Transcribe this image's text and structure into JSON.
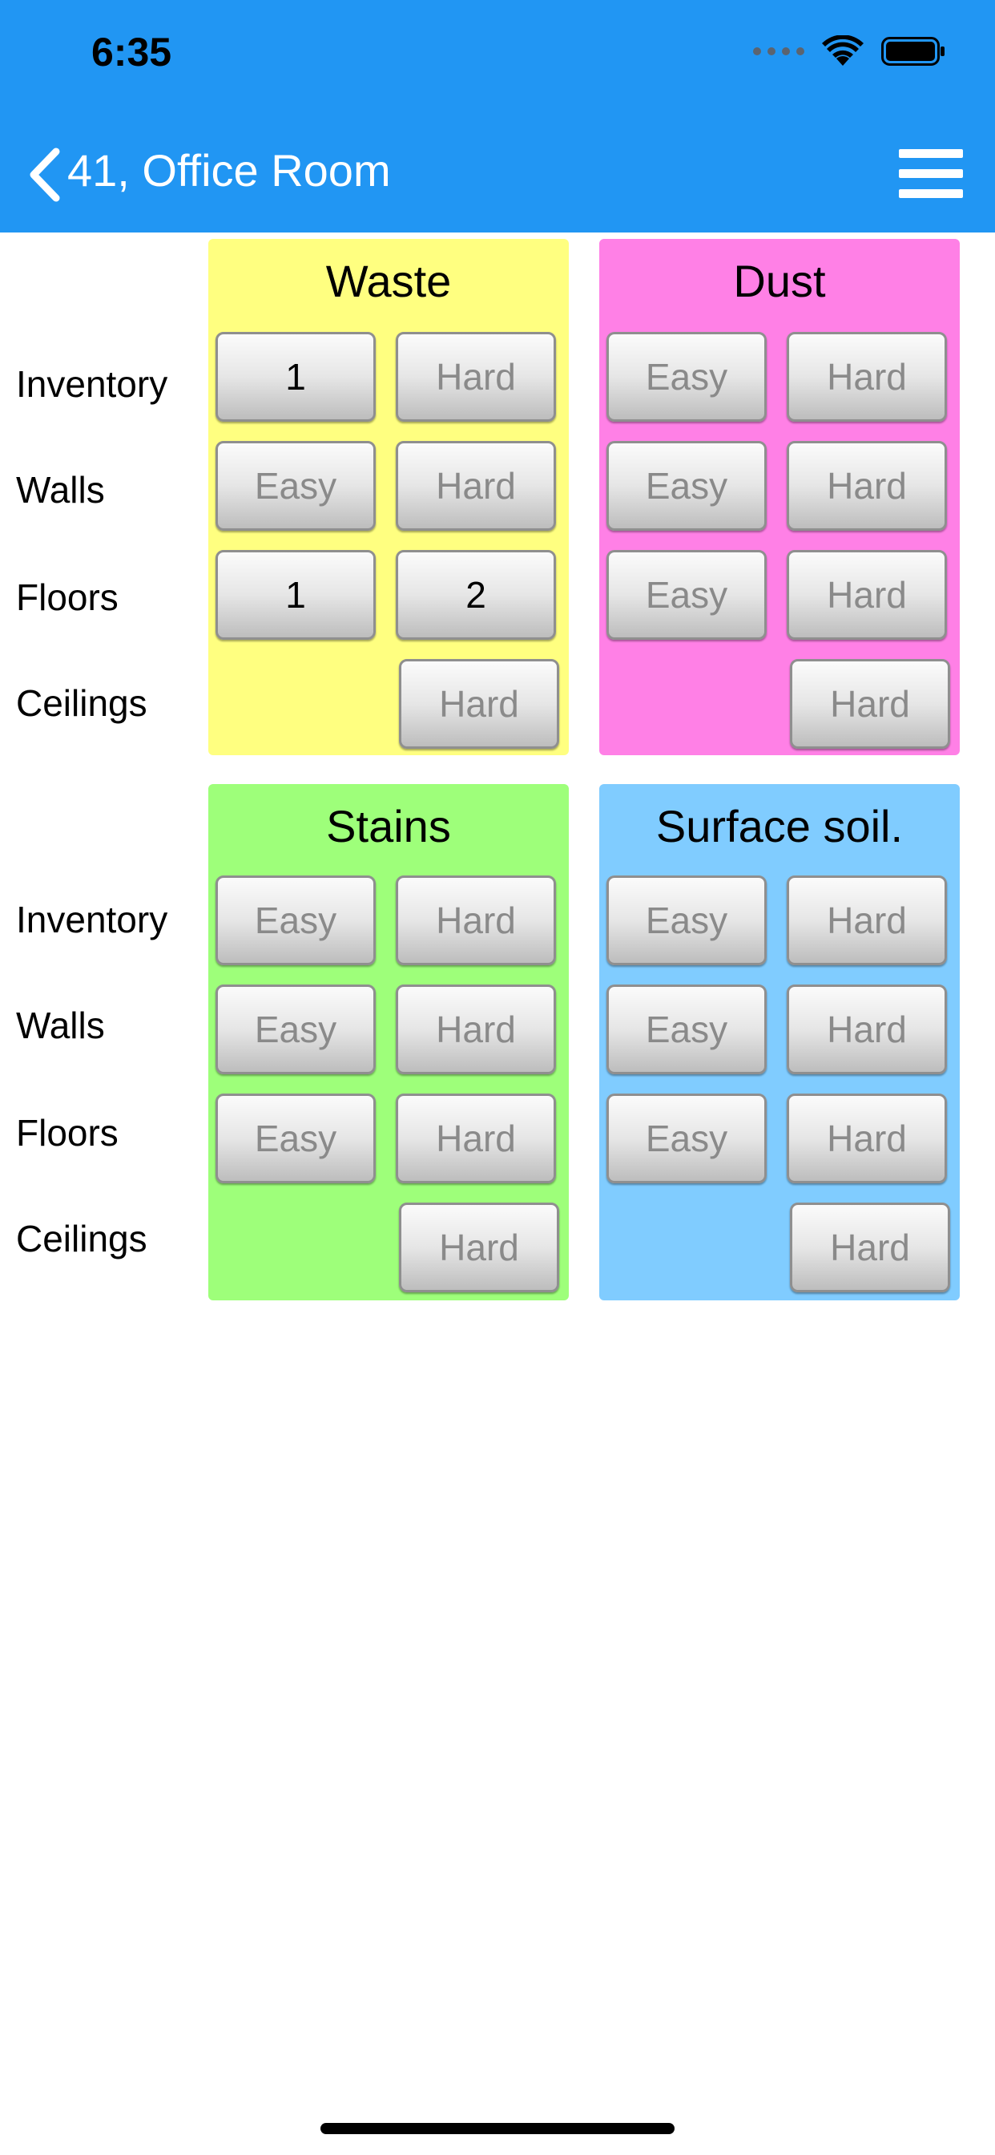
{
  "status_bar": {
    "time": "6:35"
  },
  "nav": {
    "title": "41, Office Room"
  },
  "row_labels": [
    "Inventory",
    "Walls",
    "Floors",
    "Ceilings"
  ],
  "panels": [
    {
      "title": "Waste",
      "color": "#FFFF80",
      "buttons": [
        [
          "1",
          "Hard"
        ],
        [
          "Easy",
          "Hard"
        ],
        [
          "1",
          "2"
        ],
        [
          "Hard"
        ]
      ],
      "active": [
        [
          true,
          false
        ],
        [
          false,
          false
        ],
        [
          true,
          true
        ],
        [
          false
        ]
      ]
    },
    {
      "title": "Dust",
      "color": "#FF80E6",
      "buttons": [
        [
          "Easy",
          "Hard"
        ],
        [
          "Easy",
          "Hard"
        ],
        [
          "Easy",
          "Hard"
        ],
        [
          "Hard"
        ]
      ],
      "active": [
        [
          false,
          false
        ],
        [
          false,
          false
        ],
        [
          false,
          false
        ],
        [
          false
        ]
      ]
    },
    {
      "title": "Stains",
      "color": "#9EFF7A",
      "buttons": [
        [
          "Easy",
          "Hard"
        ],
        [
          "Easy",
          "Hard"
        ],
        [
          "Easy",
          "Hard"
        ],
        [
          "Hard"
        ]
      ],
      "active": [
        [
          false,
          false
        ],
        [
          false,
          false
        ],
        [
          false,
          false
        ],
        [
          false
        ]
      ]
    },
    {
      "title": "Surface soil.",
      "color": "#80CCFF",
      "buttons": [
        [
          "Easy",
          "Hard"
        ],
        [
          "Easy",
          "Hard"
        ],
        [
          "Easy",
          "Hard"
        ],
        [
          "Hard"
        ]
      ],
      "active": [
        [
          false,
          false
        ],
        [
          false,
          false
        ],
        [
          false,
          false
        ],
        [
          false
        ]
      ]
    }
  ]
}
